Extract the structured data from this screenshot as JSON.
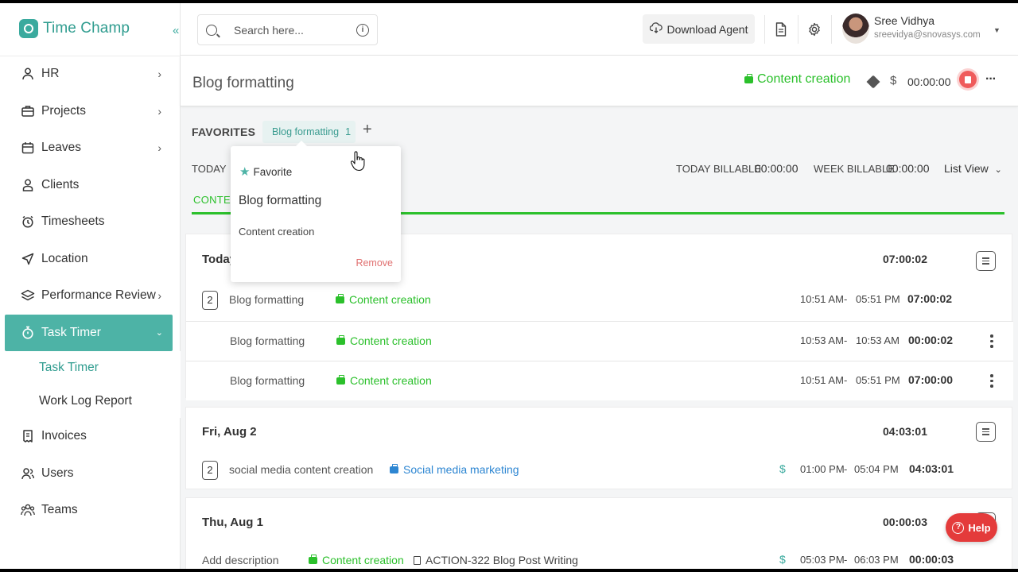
{
  "app": {
    "name": "Time Champ",
    "collapse_icon": "«"
  },
  "sidebar": {
    "items": [
      {
        "label": "HR",
        "icon": "person-icon",
        "chevron": true
      },
      {
        "label": "Projects",
        "icon": "briefcase-icon",
        "chevron": true
      },
      {
        "label": "Leaves",
        "icon": "calendar-icon",
        "chevron": true
      },
      {
        "label": "Clients",
        "icon": "client-icon",
        "chevron": false
      },
      {
        "label": "Timesheets",
        "icon": "alarm-icon",
        "chevron": false
      },
      {
        "label": "Location",
        "icon": "location-arrow-icon",
        "chevron": false
      },
      {
        "label": "Performance Review",
        "icon": "review-icon",
        "chevron": true
      }
    ],
    "active": {
      "label": "Task Timer",
      "icon": "stopwatch-icon"
    },
    "sub_items": [
      {
        "label": "Task Timer",
        "selected": true
      },
      {
        "label": "Work Log Report",
        "selected": false
      }
    ],
    "bottom_items": [
      {
        "label": "Invoices",
        "icon": "invoice-icon"
      },
      {
        "label": "Users",
        "icon": "users-icon"
      },
      {
        "label": "Teams",
        "icon": "teams-icon"
      }
    ]
  },
  "topbar": {
    "search_placeholder": "Search here...",
    "download_label": "Download Agent",
    "user_name": "Sree Vidhya",
    "user_email": "sreevidya@snovasys.com"
  },
  "header": {
    "title": "Blog formatting",
    "project": "Content creation",
    "dollar": "$",
    "timer": "00:00:00",
    "more": "···"
  },
  "favorites": {
    "label": "FAVORITES",
    "chip_label": "Blog formatting",
    "chip_count": "1",
    "add": "+"
  },
  "summary": {
    "today_label": "TODAY",
    "today_billable_label": "TODAY BILLABLE",
    "today_billable": "00:00:00",
    "week_billable_label": "WEEK BILLABLE",
    "week_billable": "00:00:00",
    "view": "List View"
  },
  "tab_label": "CONTEN",
  "popover": {
    "favorite": "Favorite",
    "title": "Blog formatting",
    "project": "Content creation",
    "remove": "Remove"
  },
  "days": [
    {
      "title": "Today",
      "total": "07:00:02",
      "group": {
        "count": "2",
        "desc": "Blog formatting",
        "project": "Content creation",
        "start": "10:51 AM",
        "end": "05:51 PM",
        "duration": "07:00:02"
      },
      "entries": [
        {
          "desc": "Blog formatting",
          "project": "Content creation",
          "start": "10:53 AM",
          "end": "10:53 AM",
          "duration": "00:00:02"
        },
        {
          "desc": "Blog formatting",
          "project": "Content creation",
          "start": "10:51 AM",
          "end": "05:51 PM",
          "duration": "07:00:00"
        }
      ]
    },
    {
      "title": "Fri, Aug 2",
      "total": "04:03:01",
      "group": {
        "count": "2",
        "desc": "social media content creation",
        "project": "Social media marketing",
        "start": "01:00 PM",
        "end": "05:04 PM",
        "duration": "04:03:01"
      }
    },
    {
      "title": "Thu, Aug 1",
      "total": "00:00:03",
      "entry": {
        "desc": "Add description",
        "project": "Content creation",
        "task": "ACTION-322 Blog Post Writing",
        "start": "05:03 PM",
        "end": "06:03 PM",
        "duration": "00:00:03"
      }
    }
  ],
  "separator": "-",
  "help_label": "Help",
  "colors": {
    "brand": "#3aaa9e",
    "project_green": "#2bc02b",
    "project_blue": "#2d86d2",
    "stop_red": "#ef5b5b",
    "help_red": "#e43b3b"
  }
}
